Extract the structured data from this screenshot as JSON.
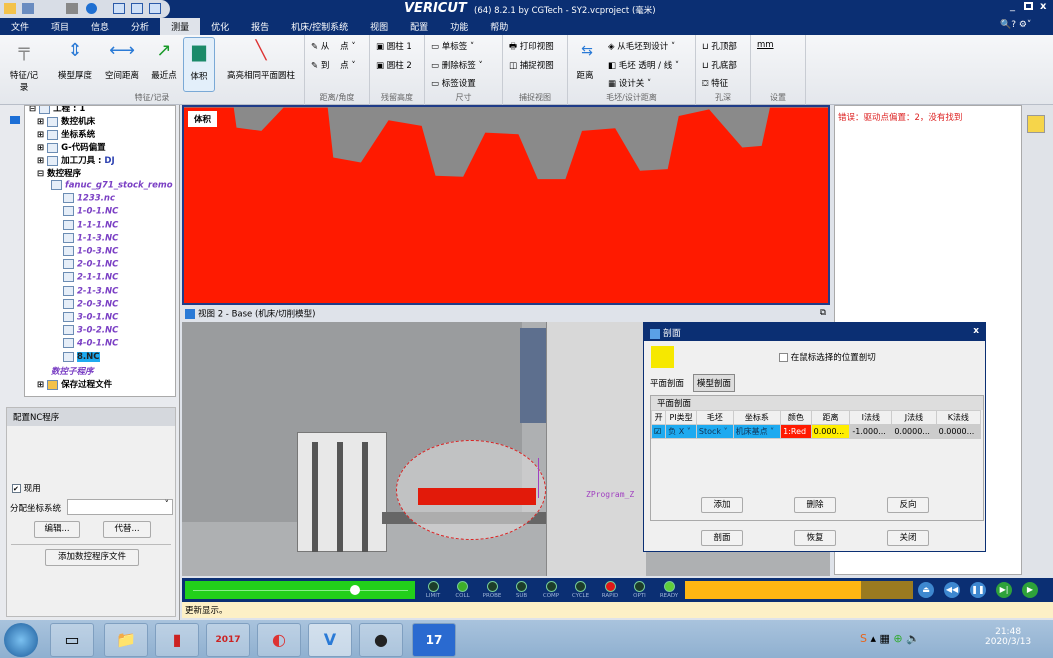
{
  "window": {
    "app": "VERICUT",
    "title": "(64) 8.2.1 by CGTech - SY2.vcproject (毫米)"
  },
  "menu": [
    "文件",
    "项目",
    "信息",
    "分析",
    "测量",
    "优化",
    "报告",
    "机床/控制系统",
    "视图",
    "配置",
    "功能",
    "帮助"
  ],
  "menu_active": "测量",
  "ribbon": {
    "feature_group": {
      "label": "特征/记录",
      "buttons": [
        "特征/记录",
        "模型厚度",
        "空间距离",
        "最近点",
        "体积",
        "高亮相同平面圆柱"
      ]
    },
    "distance_group": {
      "label": "距离/角度",
      "from": "从",
      "to": "到",
      "point": "点"
    },
    "residual_group": {
      "label": "残留高度",
      "cyl1": "圆柱 1",
      "cyl2": "圆柱 2"
    },
    "dim_group": {
      "label": "尺寸",
      "single": "单标签",
      "delete": "删除标签",
      "settings": "标签设置"
    },
    "capture_group": {
      "label": "捕捉视图",
      "print": "打印视图",
      "capture": "捕捉视图"
    },
    "stock_group": {
      "label": "毛坯/设计距离",
      "distance": "距离",
      "from_stock": "从毛坯到设计",
      "transparent": "毛坯 透明 / 线",
      "design_off": "设计关"
    },
    "hole_group": {
      "label": "孔深",
      "top": "孔顶部",
      "bottom": "孔底部",
      "feature": "特征"
    },
    "settings_group": {
      "label": "设置",
      "unit": "mm"
    }
  },
  "tree": {
    "root": "工程 : 1",
    "items": [
      "数控机床",
      "坐标系统",
      "G-代码偏置"
    ],
    "tool": "加工刀具 :",
    "tool_value": "DJ",
    "programs": "数控程序",
    "files": [
      "fanuc_g71_stock_remo",
      "1233.nc",
      "1-0-1.NC",
      "1-1-1.NC",
      "1-1-3.NC",
      "1-0-3.NC",
      "2-0-1.NC",
      "2-1-1.NC",
      "2-1-3.NC",
      "2-0-3.NC",
      "3-0-1.NC",
      "3-0-2.NC",
      "4-0-1.NC",
      "8.NC"
    ],
    "selected": "8.NC",
    "subprograms": "数控子程序",
    "save": "保存过程文件"
  },
  "config": {
    "title": "配置NC程序",
    "active_label": "现用",
    "active": true,
    "coord_label": "分配坐标系统",
    "coord_value": "",
    "edit": "编辑...",
    "replace": "代替...",
    "add_file": "添加数控程序文件"
  },
  "view1": {
    "label": "体积"
  },
  "view2": {
    "title": "视图 2 - Base (机床/切削模型)",
    "axis_label": "ZProgram_Z"
  },
  "right_panel": {
    "error": "错误：驱动点偏置：2，没有找到"
  },
  "dialog": {
    "title": "剖面",
    "checkbox": "在鼠标选择的位置剖切",
    "checked": false,
    "tabs": [
      "平面剖面",
      "模型剖面"
    ],
    "group": "平面剖面",
    "columns": [
      "开",
      "PI类型",
      "毛坯",
      "坐标系",
      "颜色",
      "距离",
      "I法线",
      "J法线",
      "K法线"
    ],
    "row": {
      "on": true,
      "type": "负 X",
      "stock": "Stock",
      "coord": "机床基点",
      "color": "1:Red",
      "distance": "0.000...",
      "i": "-1.000...",
      "j": "0.0000...",
      "k": "0.0000..."
    },
    "add": "添加",
    "delete": "删除",
    "reverse": "反向",
    "section": "剖面",
    "restore": "恢复",
    "close": "关闭"
  },
  "controls": {
    "progress": 0.77,
    "leds": [
      {
        "label": "LIMIT",
        "color": "#1d3d2a"
      },
      {
        "label": "COLL",
        "color": "#3fae2a"
      },
      {
        "label": "PROBE",
        "color": "#1d3d2a"
      },
      {
        "label": "SUB",
        "color": "#1d3d2a"
      },
      {
        "label": "COMP",
        "color": "#1d3d2a"
      },
      {
        "label": "CYCLE",
        "color": "#1d3d2a"
      },
      {
        "label": "RAPID",
        "color": "#e01818"
      },
      {
        "label": "OPTI",
        "color": "#1d3d2a"
      },
      {
        "label": "READY",
        "color": "#5fcf3a"
      }
    ]
  },
  "status": "更新显示。",
  "taskbar": {
    "time": "21:48",
    "date": "2020/3/13",
    "app_2017": "2017",
    "app_17": "17"
  },
  "colors": {
    "title": "#0b2f73",
    "cut": "#ff1a00",
    "stock": "#888888",
    "progress": "#22d01a",
    "bar": "#ffb612"
  }
}
